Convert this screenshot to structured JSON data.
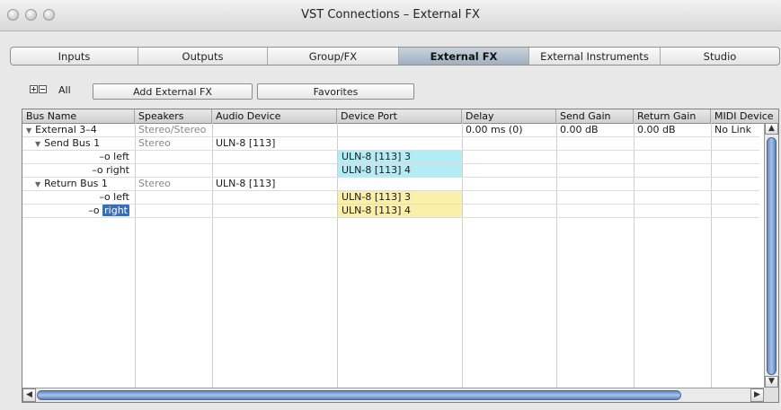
{
  "window": {
    "title": "VST Connections – External FX"
  },
  "tabs": [
    {
      "label": "Inputs",
      "active": false
    },
    {
      "label": "Outputs",
      "active": false
    },
    {
      "label": "Group/FX",
      "active": false
    },
    {
      "label": "External FX",
      "active": true
    },
    {
      "label": "External Instruments",
      "active": false
    },
    {
      "label": "Studio",
      "active": false
    }
  ],
  "toolbar": {
    "all_label": "All",
    "add_button": "Add External FX",
    "favorites_button": "Favorites"
  },
  "table": {
    "columns": [
      "Bus Name",
      "Speakers",
      "Audio Device",
      "Device Port",
      "Delay",
      "Send Gain",
      "Return Gain",
      "MIDI Device"
    ],
    "rows": [
      {
        "bus": "External 3–4",
        "speakers": "Stereo/Stereo",
        "device": "",
        "port": "",
        "delay": "0.00 ms (0)",
        "send_gain": "0.00 dB",
        "return_gain": "0.00 dB",
        "midi": "No Link"
      },
      {
        "bus": "Send Bus 1",
        "speakers": "Stereo",
        "device": "ULN-8 [113]",
        "port": "",
        "delay": "",
        "send_gain": "",
        "return_gain": "",
        "midi": ""
      },
      {
        "bus": "left",
        "speakers": "",
        "device": "",
        "port": "ULN-8 [113] 3",
        "delay": "",
        "send_gain": "",
        "return_gain": "",
        "midi": ""
      },
      {
        "bus": "right",
        "speakers": "",
        "device": "",
        "port": "ULN-8 [113] 4",
        "delay": "",
        "send_gain": "",
        "return_gain": "",
        "midi": ""
      },
      {
        "bus": "Return Bus 1",
        "speakers": "Stereo",
        "device": "ULN-8 [113]",
        "port": "",
        "delay": "",
        "send_gain": "",
        "return_gain": "",
        "midi": ""
      },
      {
        "bus": "left",
        "speakers": "",
        "device": "",
        "port": "ULN-8 [113] 3",
        "delay": "",
        "send_gain": "",
        "return_gain": "",
        "midi": ""
      },
      {
        "bus": "right",
        "speakers": "",
        "device": "",
        "port": "ULN-8 [113] 4",
        "delay": "",
        "send_gain": "",
        "return_gain": "",
        "midi": ""
      }
    ],
    "port_symbol": "–o"
  },
  "colors": {
    "send_port": "#b4ecf5",
    "return_port": "#fbf0a9",
    "selection": "#3b6db7"
  }
}
